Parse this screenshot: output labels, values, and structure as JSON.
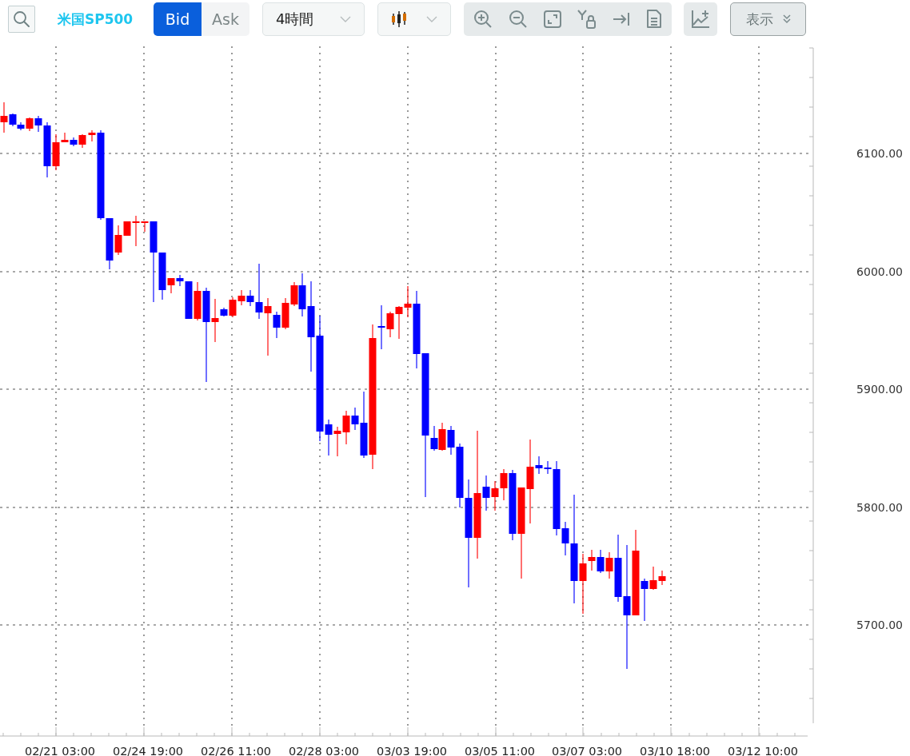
{
  "toolbar": {
    "symbol": "米国SP500",
    "price_sides": [
      {
        "label": "Bid",
        "selected": true
      },
      {
        "label": "Ask",
        "selected": false
      }
    ],
    "timeframe": "4時間",
    "view_menu": "表示"
  },
  "chart": {
    "y_labels": [
      "6100.00",
      "6000.00",
      "5900.00",
      "5800.00",
      "5700.00"
    ],
    "x_labels": [
      "02/21 03:00",
      "02/24 19:00",
      "02/26 11:00",
      "02/28 03:00",
      "03/03 19:00",
      "03/05 11:00",
      "03/07 03:00",
      "03/10 18:00",
      "03/12 10:00"
    ]
  }
}
